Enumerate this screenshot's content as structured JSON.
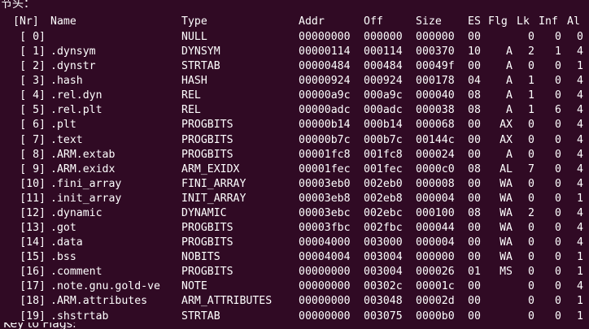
{
  "heading": "节头：",
  "columns": {
    "nr": "[Nr]",
    "name": "Name",
    "type": "Type",
    "addr": "Addr",
    "off": "Off",
    "size": "Size",
    "es": "ES",
    "flg": "Flg",
    "lk": "Lk",
    "inf": "Inf",
    "al": "Al"
  },
  "sections": [
    {
      "nr": "[ 0]",
      "name": "",
      "type": "NULL",
      "addr": "00000000",
      "off": "000000",
      "size": "000000",
      "es": "00",
      "flg": "",
      "lk": "0",
      "inf": "0",
      "al": "0"
    },
    {
      "nr": "[ 1]",
      "name": ".dynsym",
      "type": "DYNSYM",
      "addr": "00000114",
      "off": "000114",
      "size": "000370",
      "es": "10",
      "flg": "A",
      "lk": "2",
      "inf": "1",
      "al": "4"
    },
    {
      "nr": "[ 2]",
      "name": ".dynstr",
      "type": "STRTAB",
      "addr": "00000484",
      "off": "000484",
      "size": "00049f",
      "es": "00",
      "flg": "A",
      "lk": "0",
      "inf": "0",
      "al": "1"
    },
    {
      "nr": "[ 3]",
      "name": ".hash",
      "type": "HASH",
      "addr": "00000924",
      "off": "000924",
      "size": "000178",
      "es": "04",
      "flg": "A",
      "lk": "1",
      "inf": "0",
      "al": "4"
    },
    {
      "nr": "[ 4]",
      "name": ".rel.dyn",
      "type": "REL",
      "addr": "00000a9c",
      "off": "000a9c",
      "size": "000040",
      "es": "08",
      "flg": "A",
      "lk": "1",
      "inf": "0",
      "al": "4"
    },
    {
      "nr": "[ 5]",
      "name": ".rel.plt",
      "type": "REL",
      "addr": "00000adc",
      "off": "000adc",
      "size": "000038",
      "es": "08",
      "flg": "A",
      "lk": "1",
      "inf": "6",
      "al": "4"
    },
    {
      "nr": "[ 6]",
      "name": ".plt",
      "type": "PROGBITS",
      "addr": "00000b14",
      "off": "000b14",
      "size": "000068",
      "es": "00",
      "flg": "AX",
      "lk": "0",
      "inf": "0",
      "al": "4"
    },
    {
      "nr": "[ 7]",
      "name": ".text",
      "type": "PROGBITS",
      "addr": "00000b7c",
      "off": "000b7c",
      "size": "00144c",
      "es": "00",
      "flg": "AX",
      "lk": "0",
      "inf": "0",
      "al": "4"
    },
    {
      "nr": "[ 8]",
      "name": ".ARM.extab",
      "type": "PROGBITS",
      "addr": "00001fc8",
      "off": "001fc8",
      "size": "000024",
      "es": "00",
      "flg": "A",
      "lk": "0",
      "inf": "0",
      "al": "4"
    },
    {
      "nr": "[ 9]",
      "name": ".ARM.exidx",
      "type": "ARM_EXIDX",
      "addr": "00001fec",
      "off": "001fec",
      "size": "0000c0",
      "es": "08",
      "flg": "AL",
      "lk": "7",
      "inf": "0",
      "al": "4"
    },
    {
      "nr": "[10]",
      "name": ".fini_array",
      "type": "FINI_ARRAY",
      "addr": "00003eb0",
      "off": "002eb0",
      "size": "000008",
      "es": "00",
      "flg": "WA",
      "lk": "0",
      "inf": "0",
      "al": "4"
    },
    {
      "nr": "[11]",
      "name": ".init_array",
      "type": "INIT_ARRAY",
      "addr": "00003eb8",
      "off": "002eb8",
      "size": "000004",
      "es": "00",
      "flg": "WA",
      "lk": "0",
      "inf": "0",
      "al": "1"
    },
    {
      "nr": "[12]",
      "name": ".dynamic",
      "type": "DYNAMIC",
      "addr": "00003ebc",
      "off": "002ebc",
      "size": "000100",
      "es": "08",
      "flg": "WA",
      "lk": "2",
      "inf": "0",
      "al": "4"
    },
    {
      "nr": "[13]",
      "name": ".got",
      "type": "PROGBITS",
      "addr": "00003fbc",
      "off": "002fbc",
      "size": "000044",
      "es": "00",
      "flg": "WA",
      "lk": "0",
      "inf": "0",
      "al": "4"
    },
    {
      "nr": "[14]",
      "name": ".data",
      "type": "PROGBITS",
      "addr": "00004000",
      "off": "003000",
      "size": "000004",
      "es": "00",
      "flg": "WA",
      "lk": "0",
      "inf": "0",
      "al": "4"
    },
    {
      "nr": "[15]",
      "name": ".bss",
      "type": "NOBITS",
      "addr": "00004004",
      "off": "003004",
      "size": "000000",
      "es": "00",
      "flg": "WA",
      "lk": "0",
      "inf": "0",
      "al": "1"
    },
    {
      "nr": "[16]",
      "name": ".comment",
      "type": "PROGBITS",
      "addr": "00000000",
      "off": "003004",
      "size": "000026",
      "es": "01",
      "flg": "MS",
      "lk": "0",
      "inf": "0",
      "al": "1"
    },
    {
      "nr": "[17]",
      "name": ".note.gnu.gold-ve",
      "type": "NOTE",
      "addr": "00000000",
      "off": "00302c",
      "size": "00001c",
      "es": "00",
      "flg": "",
      "lk": "0",
      "inf": "0",
      "al": "4"
    },
    {
      "nr": "[18]",
      "name": ".ARM.attributes",
      "type": "ARM_ATTRIBUTES",
      "addr": "00000000",
      "off": "003048",
      "size": "00002d",
      "es": "00",
      "flg": "",
      "lk": "0",
      "inf": "0",
      "al": "1"
    },
    {
      "nr": "[19]",
      "name": ".shstrtab",
      "type": "STRTAB",
      "addr": "00000000",
      "off": "003075",
      "size": "0000b0",
      "es": "00",
      "flg": "",
      "lk": "0",
      "inf": "0",
      "al": "1"
    }
  ],
  "cutoff_line": "Key to Flags:"
}
